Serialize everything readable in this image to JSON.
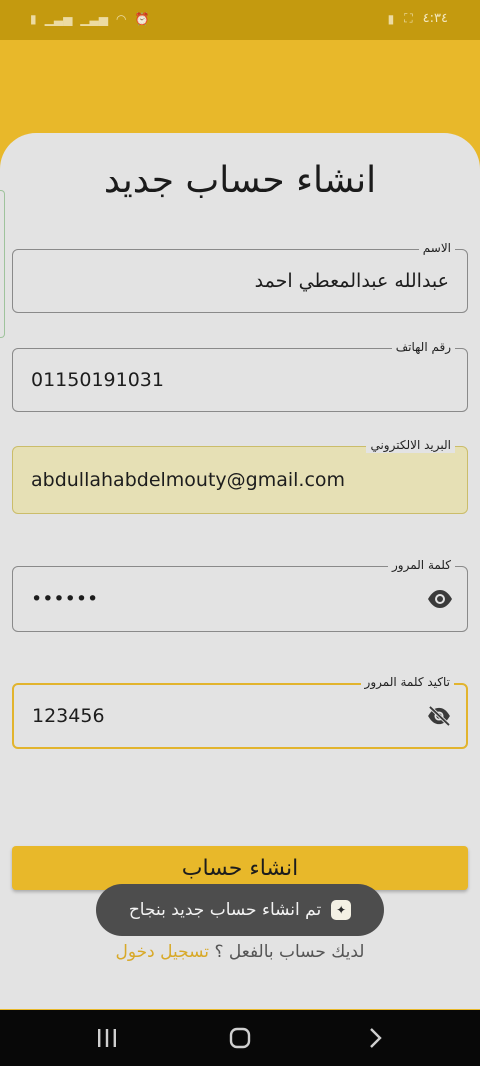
{
  "status": {
    "time": "٤:٣٤"
  },
  "page": {
    "title": "انشاء حساب جديد"
  },
  "form": {
    "name": {
      "label": "الاسم",
      "value": "عبدالله عبدالمعطي احمد"
    },
    "phone": {
      "label": "رقم الهاتف",
      "value": "01150191031"
    },
    "email": {
      "label": "البريد الالكتروني",
      "value": "abdullahabdelmouty@gmail.com"
    },
    "password": {
      "label": "كلمة المرور",
      "value": "••••••",
      "icon": "eye-icon"
    },
    "confirm": {
      "label": "تاكيد كلمة المرور",
      "value": "123456",
      "icon": "eye-off-icon"
    },
    "submit_label": "انشاء حساب"
  },
  "toast": {
    "message": "تم انشاء حساب جديد بنجاح"
  },
  "login": {
    "question": "لديك حساب بالفعل ؟",
    "link": "تسجيل دخول"
  },
  "colors": {
    "accent": "#e8b82a",
    "card": "#e3e3e3",
    "toast": "#4d4d4d"
  }
}
